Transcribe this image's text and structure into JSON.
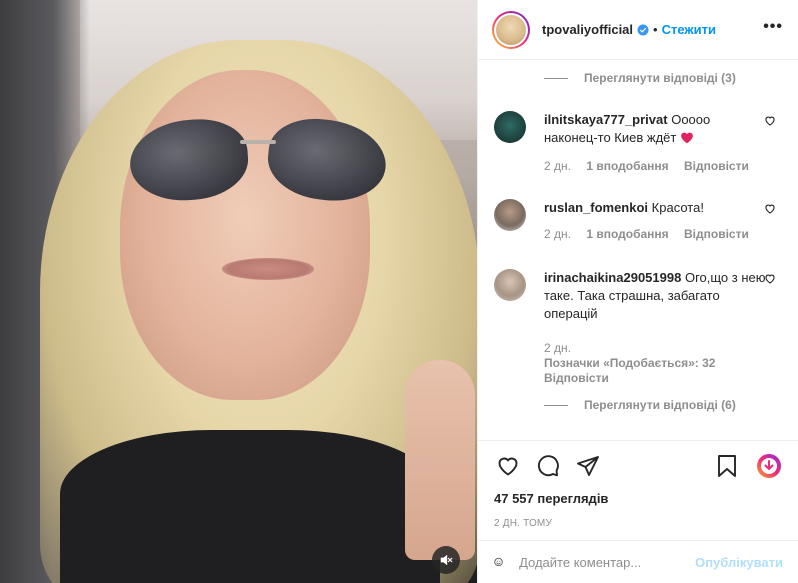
{
  "post": {
    "username": "tpovaliyofficial",
    "follow_label": "Стежити",
    "dot": "•",
    "more_label": "•••"
  },
  "comments": {
    "view_replies_top": "Переглянути відповіді (3)",
    "items": [
      {
        "username": "ilnitskaya777_privat",
        "text": "Ооооо наконец-то Киев ждёт",
        "emoji": "❤️",
        "time": "2 дн.",
        "likes": "1 вподобання",
        "reply": "Відповісти"
      },
      {
        "username": "ruslan_fomenkoi",
        "text": "Красота!",
        "time": "2 дн.",
        "likes": "1 вподобання",
        "reply": "Відповісти"
      },
      {
        "username": "irinachaikina29051998",
        "text": "Ого,що з нею таке. Така страшна, забагато операцій",
        "time": "2 дн.",
        "likes": "Позначки «Подобається»: 32",
        "reply": "Відповісти"
      }
    ],
    "view_replies_bottom": "Переглянути відповіді (6)"
  },
  "stats": {
    "views": "47 557 переглядів",
    "posted": "2 ДН. ТОМУ"
  },
  "add_comment": {
    "placeholder": "Додайте коментар...",
    "publish_label": "Опублікувати"
  },
  "icons": [
    "like-icon",
    "comment-icon",
    "share-icon",
    "save-icon",
    "download-extension-icon",
    "mute-icon",
    "emoji-icon",
    "verified-icon",
    "heart-small-icon"
  ],
  "colors": {
    "accent": "#0095f6",
    "publish_disabled": "#b2dffc",
    "muted": "#8e8e8e",
    "heart": "#ed4956"
  }
}
